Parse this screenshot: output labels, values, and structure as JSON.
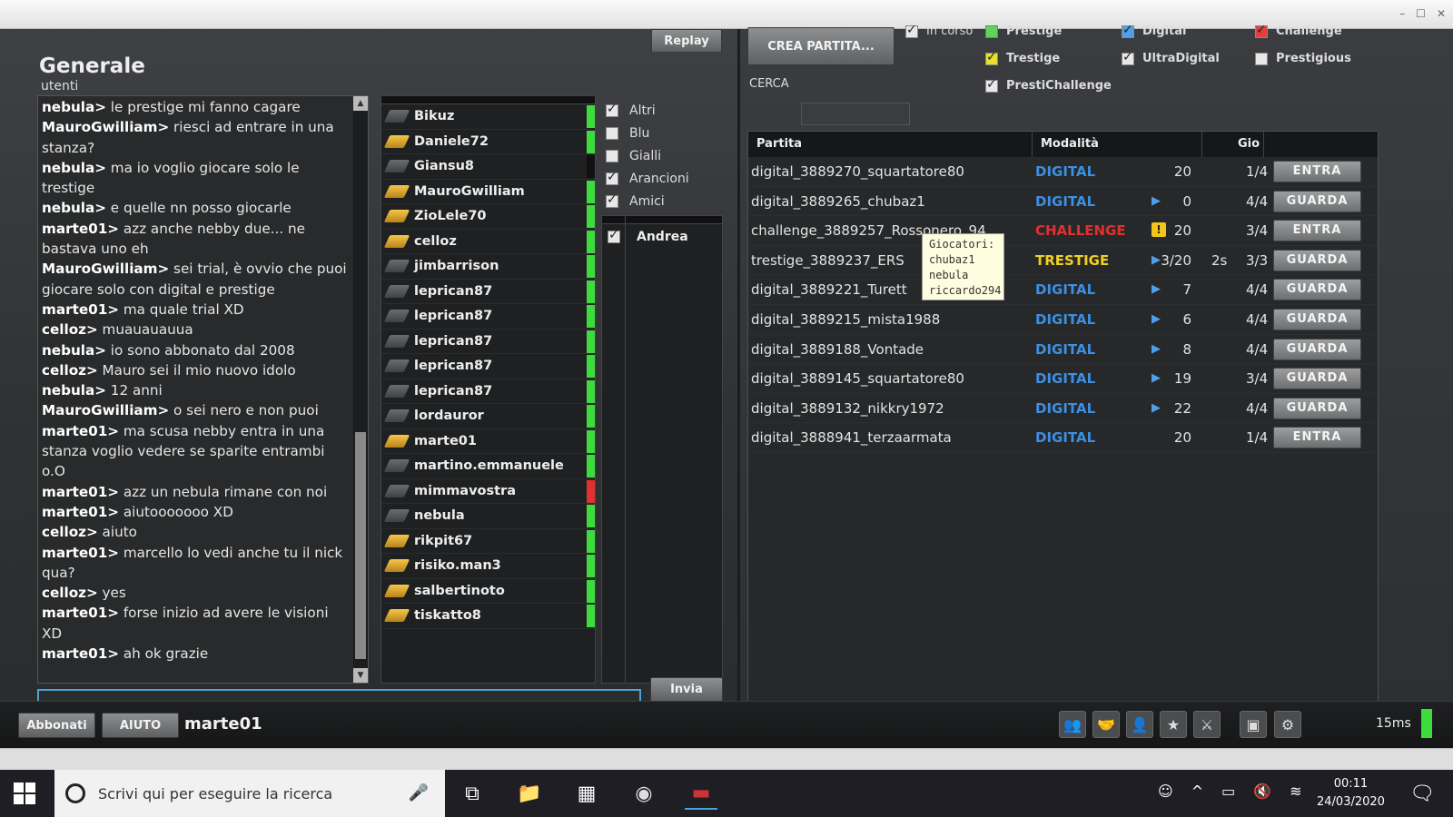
{
  "window": {
    "controls": [
      "–",
      "☐",
      "✕"
    ]
  },
  "room": {
    "title": "Generale",
    "subtitle": "utenti",
    "replay": "Replay",
    "send": "Invia"
  },
  "chat": [
    {
      "u": "nebula",
      "m": "le prestige mi fanno cagare"
    },
    {
      "u": "MauroGwilliam",
      "m": "riesci ad entrare in una stanza?"
    },
    {
      "u": "nebula",
      "m": "ma io voglio giocare solo le trestige"
    },
    {
      "u": "nebula",
      "m": "e quelle nn posso giocarle"
    },
    {
      "u": "marte01",
      "m": "azz anche nebby due... ne bastava uno eh"
    },
    {
      "u": "MauroGwilliam",
      "m": "sei trial, è ovvio che puoi giocare solo con digital e prestige"
    },
    {
      "u": "marte01",
      "m": "ma quale trial XD"
    },
    {
      "u": "celloz",
      "m": "muauauauua"
    },
    {
      "u": "nebula",
      "m": "io sono abbonato dal 2008"
    },
    {
      "u": "celloz",
      "m": "Mauro sei il mio nuovo idolo"
    },
    {
      "u": "nebula",
      "m": "12 anni"
    },
    {
      "u": "MauroGwilliam",
      "m": "o sei nero e non puoi"
    },
    {
      "u": "marte01",
      "m": "ma scusa nebby entra in una stanza voglio vedere se sparite entrambi o.O"
    },
    {
      "u": "marte01",
      "m": "azz un nebula rimane con noi"
    },
    {
      "u": "marte01",
      "m": "aiutooooooo XD"
    },
    {
      "u": "celloz",
      "m": "aiuto"
    },
    {
      "u": "marte01",
      "m": "marcello lo vedi anche tu il nick qua?"
    },
    {
      "u": "celloz",
      "m": "yes"
    },
    {
      "u": "marte01",
      "m": "forse inizio ad avere le visioni XD"
    },
    {
      "u": "marte01",
      "m": "ah ok grazie"
    }
  ],
  "users": [
    {
      "n": "Bikuz",
      "i": "gray",
      "s": "#3ddc3d"
    },
    {
      "n": "Daniele72",
      "i": "gold",
      "s": "#3ddc3d"
    },
    {
      "n": "Giansu8",
      "i": "gray",
      "s": "#111111"
    },
    {
      "n": "MauroGwilliam",
      "i": "gold",
      "s": "#3ddc3d"
    },
    {
      "n": "ZioLele70",
      "i": "gold",
      "s": "#3ddc3d"
    },
    {
      "n": "celloz",
      "i": "gold",
      "s": "#3ddc3d"
    },
    {
      "n": "jimbarrison",
      "i": "gray",
      "s": "#3ddc3d"
    },
    {
      "n": "leprican87",
      "i": "gray",
      "s": "#3ddc3d"
    },
    {
      "n": "leprican87",
      "i": "gray",
      "s": "#3ddc3d"
    },
    {
      "n": "leprican87",
      "i": "gray",
      "s": "#3ddc3d"
    },
    {
      "n": "leprican87",
      "i": "gray",
      "s": "#3ddc3d"
    },
    {
      "n": "leprican87",
      "i": "gray",
      "s": "#3ddc3d"
    },
    {
      "n": "lordauror",
      "i": "gray",
      "s": "#3ddc3d"
    },
    {
      "n": "marte01",
      "i": "gold",
      "s": "#3ddc3d"
    },
    {
      "n": "martino.emmanuele",
      "i": "gray",
      "s": "#3ddc3d"
    },
    {
      "n": "mimmavostra",
      "i": "gray",
      "s": "#e03030"
    },
    {
      "n": "nebula",
      "i": "gray",
      "s": "#3ddc3d"
    },
    {
      "n": "rikpit67",
      "i": "gold",
      "s": "#3ddc3d"
    },
    {
      "n": "risiko.man3",
      "i": "gold",
      "s": "#3ddc3d"
    },
    {
      "n": "salbertinoto",
      "i": "gold",
      "s": "#3ddc3d"
    },
    {
      "n": "tiskatto8",
      "i": "gold",
      "s": "#3ddc3d"
    }
  ],
  "filters": [
    {
      "label": "Altri",
      "on": true
    },
    {
      "label": "Blu",
      "on": false
    },
    {
      "label": "Gialli",
      "on": false
    },
    {
      "label": "Arancioni",
      "on": true
    },
    {
      "label": "Amici",
      "on": true
    }
  ],
  "friends": [
    {
      "n": "Andrea",
      "on": true
    }
  ],
  "lobby": {
    "create": "CREA PARTITA...",
    "search_label": "CERCA",
    "in_progress": "In corso",
    "types": {
      "prestige": "Prestige",
      "trestige": "Trestige",
      "presti": "PrestiChallenge",
      "digital": "Digital",
      "ultra": "UltraDigital",
      "challenge": "Challenge",
      "prestigious": "Prestigious"
    },
    "headers": {
      "match": "Partita",
      "mode": "Modalità",
      "players": "Gio"
    }
  },
  "games": [
    {
      "name": "digital_3889270_squartatore80",
      "mode": "DIGITAL",
      "color": "#3d8fe0",
      "play": false,
      "warn": false,
      "time": "20",
      "extra": "",
      "count": "1/4",
      "btn": "ENTRA"
    },
    {
      "name": "digital_3889265_chubaz1",
      "mode": "DIGITAL",
      "color": "#3d8fe0",
      "play": true,
      "warn": false,
      "time": "0",
      "extra": "",
      "count": "4/4",
      "btn": "GUARDA"
    },
    {
      "name": "challenge_3889257_Rossonero_94",
      "mode": "CHALLENGE",
      "color": "#e03030",
      "play": false,
      "warn": true,
      "time": "20",
      "extra": "",
      "count": "3/4",
      "btn": "ENTRA"
    },
    {
      "name": "trestige_3889237_ERS",
      "mode": "TRESTIGE",
      "color": "#f0d020",
      "play": true,
      "warn": false,
      "time": "3/20",
      "extra": "2s",
      "count": "3/3",
      "btn": "GUARDA"
    },
    {
      "name": "digital_3889221_Turett",
      "mode": "DIGITAL",
      "color": "#3d8fe0",
      "play": true,
      "warn": false,
      "time": "7",
      "extra": "",
      "count": "4/4",
      "btn": "GUARDA"
    },
    {
      "name": "digital_3889215_mista1988",
      "mode": "DIGITAL",
      "color": "#3d8fe0",
      "play": true,
      "warn": false,
      "time": "6",
      "extra": "",
      "count": "4/4",
      "btn": "GUARDA"
    },
    {
      "name": "digital_3889188_Vontade",
      "mode": "DIGITAL",
      "color": "#3d8fe0",
      "play": true,
      "warn": false,
      "time": "8",
      "extra": "",
      "count": "4/4",
      "btn": "GUARDA"
    },
    {
      "name": "digital_3889145_squartatore80",
      "mode": "DIGITAL",
      "color": "#3d8fe0",
      "play": true,
      "warn": false,
      "time": "19",
      "extra": "",
      "count": "3/4",
      "btn": "GUARDA"
    },
    {
      "name": "digital_3889132_nikkry1972",
      "mode": "DIGITAL",
      "color": "#3d8fe0",
      "play": true,
      "warn": false,
      "time": "22",
      "extra": "",
      "count": "4/4",
      "btn": "GUARDA"
    },
    {
      "name": "digital_3888941_terzaarmata",
      "mode": "DIGITAL",
      "color": "#3d8fe0",
      "play": false,
      "warn": false,
      "time": "20",
      "extra": "",
      "count": "1/4",
      "btn": "ENTRA"
    }
  ],
  "tooltip": {
    "title": "Giocatori:",
    "players": [
      "chubaz1",
      "nebula",
      "riccardo294"
    ]
  },
  "bottom": {
    "subs": "Abbonati",
    "help": "AIUTO",
    "user": "marte01",
    "ping": "15ms"
  },
  "taskbar": {
    "search": "Scrivi qui per eseguire la ricerca",
    "time": "00:11",
    "date": "24/03/2020"
  }
}
